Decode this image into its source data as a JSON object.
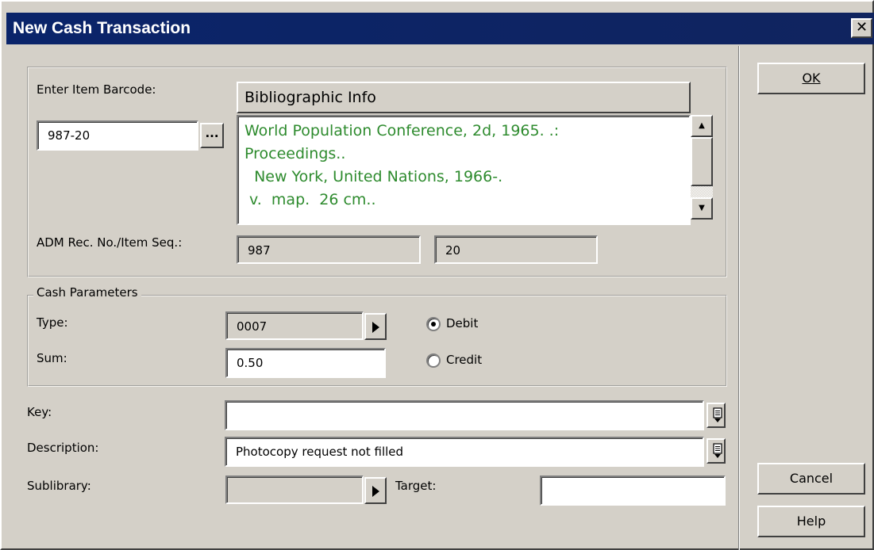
{
  "window": {
    "title": "New Cash Transaction",
    "close_glyph": "✕"
  },
  "item": {
    "barcode_label": "Enter Item Barcode:",
    "barcode_value": "987-20",
    "browse_label": "...",
    "biblio_header": "Bibliographic Info",
    "biblio_lines": [
      "World Population Conference, 2d, 1965. .:",
      "Proceedings..",
      "  New York, United Nations, 1966-.",
      " v.  map.  26 cm.."
    ],
    "adm_label": "ADM Rec. No./Item Seq.:",
    "adm_no": "987",
    "item_seq": "20"
  },
  "cash": {
    "legend": "Cash Parameters",
    "type_label": "Type:",
    "type_value": "0007",
    "sum_label": "Sum:",
    "sum_value": "0.50",
    "debit_label": "Debit",
    "credit_label": "Credit",
    "selected": "Debit"
  },
  "fields": {
    "key_label": "Key:",
    "key_value": "",
    "description_label": "Description:",
    "description_value": "Photocopy request not filled",
    "sublibrary_label": "Sublibrary:",
    "sublibrary_value": "",
    "target_label": "Target:",
    "target_value": ""
  },
  "buttons": {
    "ok": "OK",
    "cancel": "Cancel",
    "help": "Help"
  },
  "colors": {
    "title_bar": "#0a246a",
    "biblio_text": "#2e8b2e",
    "face": "#d4d0c8"
  }
}
